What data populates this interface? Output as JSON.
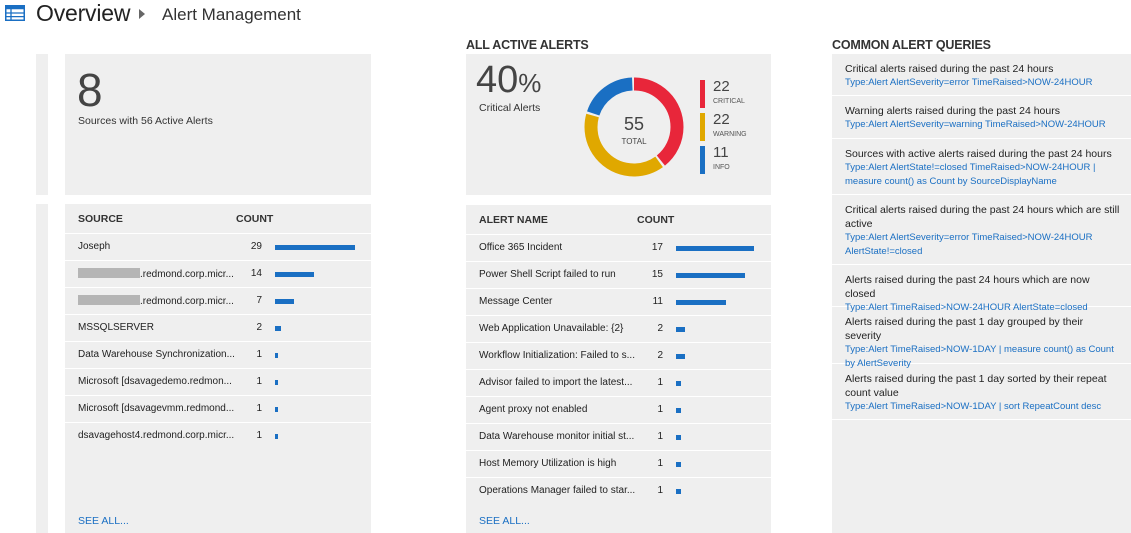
{
  "header": {
    "title": "Overview",
    "subtitle": "Alert Management"
  },
  "sources_tile": {
    "big_number": "8",
    "caption": "Sources with 56 Active Alerts"
  },
  "sources_table": {
    "col_source": "SOURCE",
    "col_count": "COUNT",
    "rows": [
      {
        "name": "Joseph",
        "count": "29",
        "value": 29,
        "redacted": false
      },
      {
        "name": ".redmond.corp.micr...",
        "count": "14",
        "value": 14,
        "redacted": true
      },
      {
        "name": ".redmond.corp.micr...",
        "count": "7",
        "value": 7,
        "redacted": true
      },
      {
        "name": "MSSQLSERVER",
        "count": "2",
        "value": 2,
        "redacted": false
      },
      {
        "name": "Data Warehouse Synchronization...",
        "count": "1",
        "value": 1,
        "redacted": false
      },
      {
        "name": "Microsoft [dsavagedemo.redmon...",
        "count": "1",
        "value": 1,
        "redacted": false
      },
      {
        "name": "Microsoft [dsavagevmm.redmond...",
        "count": "1",
        "value": 1,
        "redacted": false
      },
      {
        "name": "dsavagehost4.redmond.corp.micr...",
        "count": "1",
        "value": 1,
        "redacted": false
      }
    ],
    "see_all": "SEE ALL..."
  },
  "active_alerts": {
    "section_title": "ALL ACTIVE ALERTS",
    "percent_number": "40",
    "percent_sign": "%",
    "percent_caption": "Critical Alerts",
    "total_number": "55",
    "total_label": "TOTAL",
    "legend": [
      {
        "value": "22",
        "label": "CRITICAL",
        "color": "#e8263a"
      },
      {
        "value": "22",
        "label": "WARNING",
        "color": "#e0a800"
      },
      {
        "value": "11",
        "label": "INFO",
        "color": "#1a6fc3"
      }
    ]
  },
  "chart_data": {
    "type": "pie",
    "donut": true,
    "categories": [
      "CRITICAL",
      "WARNING",
      "INFO"
    ],
    "values": [
      22,
      22,
      11
    ],
    "colors": [
      "#e8263a",
      "#e0a800",
      "#1a6fc3"
    ],
    "center_value": 55,
    "center_label": "TOTAL"
  },
  "alerts_table": {
    "col_name": "ALERT NAME",
    "col_count": "COUNT",
    "rows": [
      {
        "name": "Office 365 Incident",
        "count": "17",
        "value": 17
      },
      {
        "name": "Power Shell Script failed to run",
        "count": "15",
        "value": 15
      },
      {
        "name": "Message Center",
        "count": "11",
        "value": 11
      },
      {
        "name": "Web Application Unavailable: {2}",
        "count": "2",
        "value": 2
      },
      {
        "name": "Workflow Initialization: Failed to s...",
        "count": "2",
        "value": 2
      },
      {
        "name": "Advisor failed to import the latest...",
        "count": "1",
        "value": 1
      },
      {
        "name": "Agent proxy not enabled",
        "count": "1",
        "value": 1
      },
      {
        "name": "Data Warehouse monitor initial st...",
        "count": "1",
        "value": 1
      },
      {
        "name": "Host Memory Utilization is high",
        "count": "1",
        "value": 1
      },
      {
        "name": "Operations Manager failed to star...",
        "count": "1",
        "value": 1
      }
    ],
    "see_all": "SEE ALL..."
  },
  "queries": {
    "section_title": "COMMON ALERT QUERIES",
    "items": [
      {
        "title": "Critical alerts raised during the past 24 hours",
        "query": "Type:Alert AlertSeverity=error TimeRaised>NOW-24HOUR"
      },
      {
        "title": "Warning alerts raised during the past 24 hours",
        "query": "Type:Alert AlertSeverity=warning TimeRaised>NOW-24HOUR"
      },
      {
        "title": "Sources with active alerts raised during the past 24 hours",
        "query": "Type:Alert AlertState!=closed TimeRaised>NOW-24HOUR | measure count() as Count by SourceDisplayName"
      },
      {
        "title": "Critical alerts raised during the past 24 hours which are still active",
        "query": "Type:Alert AlertSeverity=error TimeRaised>NOW-24HOUR AlertState!=closed"
      },
      {
        "title": "Alerts raised during the past 24 hours which are now closed",
        "query": "Type:Alert TimeRaised>NOW-24HOUR AlertState=closed"
      },
      {
        "title": "Alerts raised during the past 1 day grouped by their severity",
        "query": "Type:Alert TimeRaised>NOW-1DAY | measure count() as Count by AlertSeverity"
      },
      {
        "title": "Alerts raised during the past 1 day sorted by their repeat count value",
        "query": "Type:Alert TimeRaised>NOW-1DAY | sort RepeatCount desc"
      }
    ]
  }
}
